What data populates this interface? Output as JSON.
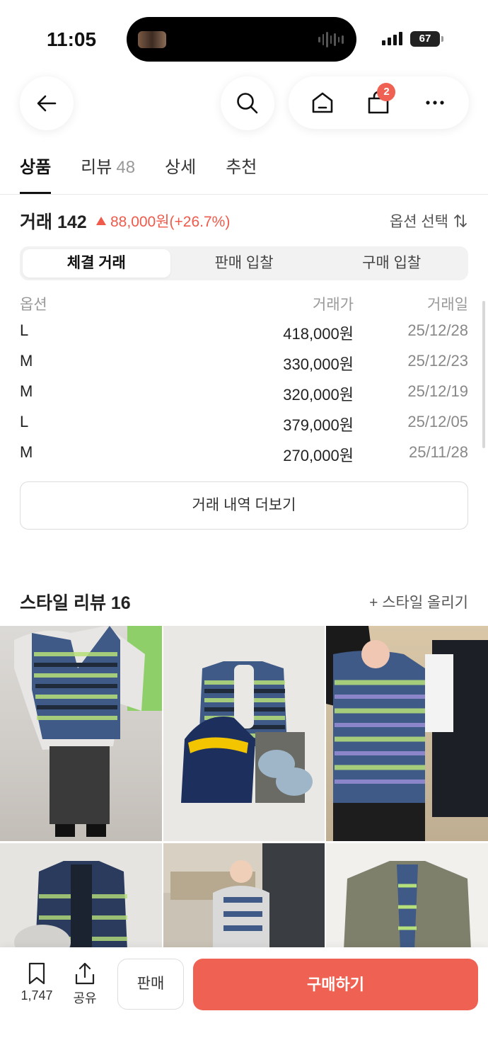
{
  "status_bar": {
    "time": "11:05",
    "battery": "67"
  },
  "header": {
    "cart_count": "2"
  },
  "tabs": [
    {
      "label": "상품",
      "count": ""
    },
    {
      "label": "리뷰",
      "count": "48"
    },
    {
      "label": "상세",
      "count": ""
    },
    {
      "label": "추천",
      "count": ""
    }
  ],
  "trade": {
    "title": "거래 142",
    "change": "88,000원(+26.7%)",
    "option_select": "옵션 선택",
    "segments": [
      "체결 거래",
      "판매 입찰",
      "구매 입찰"
    ],
    "columns": [
      "옵션",
      "거래가",
      "거래일"
    ],
    "rows": [
      {
        "option": "L",
        "price": "418,000원",
        "date": "25/12/28"
      },
      {
        "option": "M",
        "price": "330,000원",
        "date": "25/12/23"
      },
      {
        "option": "M",
        "price": "320,000원",
        "date": "25/12/19"
      },
      {
        "option": "L",
        "price": "379,000원",
        "date": "25/12/05"
      },
      {
        "option": "M",
        "price": "270,000원",
        "date": "25/11/28"
      }
    ],
    "more_label": "거래 내역 더보기"
  },
  "style_review": {
    "title": "스타일 리뷰 16",
    "upload_label": "+ 스타일 올리기"
  },
  "bottom_bar": {
    "bookmark_count": "1,747",
    "share_label": "공유",
    "sell_label": "판매",
    "buy_label": "구매하기"
  },
  "colors": {
    "accent": "#ef6253",
    "up": "#ef5a4a"
  }
}
